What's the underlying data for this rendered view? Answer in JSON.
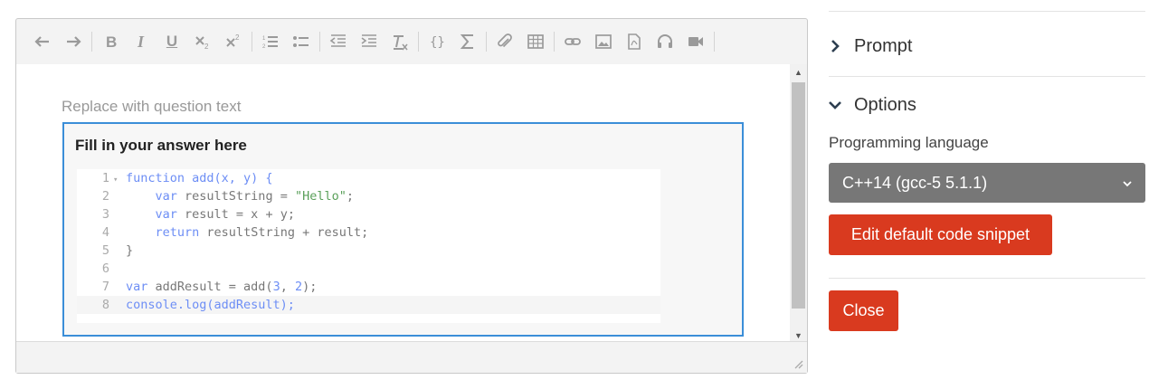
{
  "editor": {
    "toolbar": {
      "underline_label": "U",
      "tools": [
        "undo",
        "redo",
        "bold",
        "italic",
        "underline",
        "subscript",
        "superscript",
        "numbered-list",
        "bullet-list",
        "outdent",
        "indent",
        "clear-format",
        "code",
        "formula",
        "attachment",
        "table",
        "link",
        "image",
        "pdf",
        "audio",
        "video"
      ]
    },
    "placeholder": "Replace with question text",
    "answer_box": {
      "title": "Fill in your answer here",
      "line_numbers": [
        "1",
        "2",
        "3",
        "4",
        "5",
        "6",
        "7",
        "8"
      ],
      "code_lines": [
        "function add(x, y) {",
        "    var resultString = \"Hello\";",
        "    var result = x + y;",
        "    return resultString + result;",
        "}",
        "",
        "var addResult = add(3, 2);",
        "console.log(addResult);"
      ]
    }
  },
  "panel": {
    "prompt_label": "Prompt",
    "options_label": "Options",
    "programming_language_label": "Programming language",
    "selected_language": "C++14 (gcc-5 5.1.1)",
    "edit_snippet_label": "Edit default code snippet",
    "close_label": "Close"
  },
  "colors": {
    "accent_red": "#d93a1f",
    "focus_blue": "#3b8ed8",
    "select_gray": "#777777"
  }
}
